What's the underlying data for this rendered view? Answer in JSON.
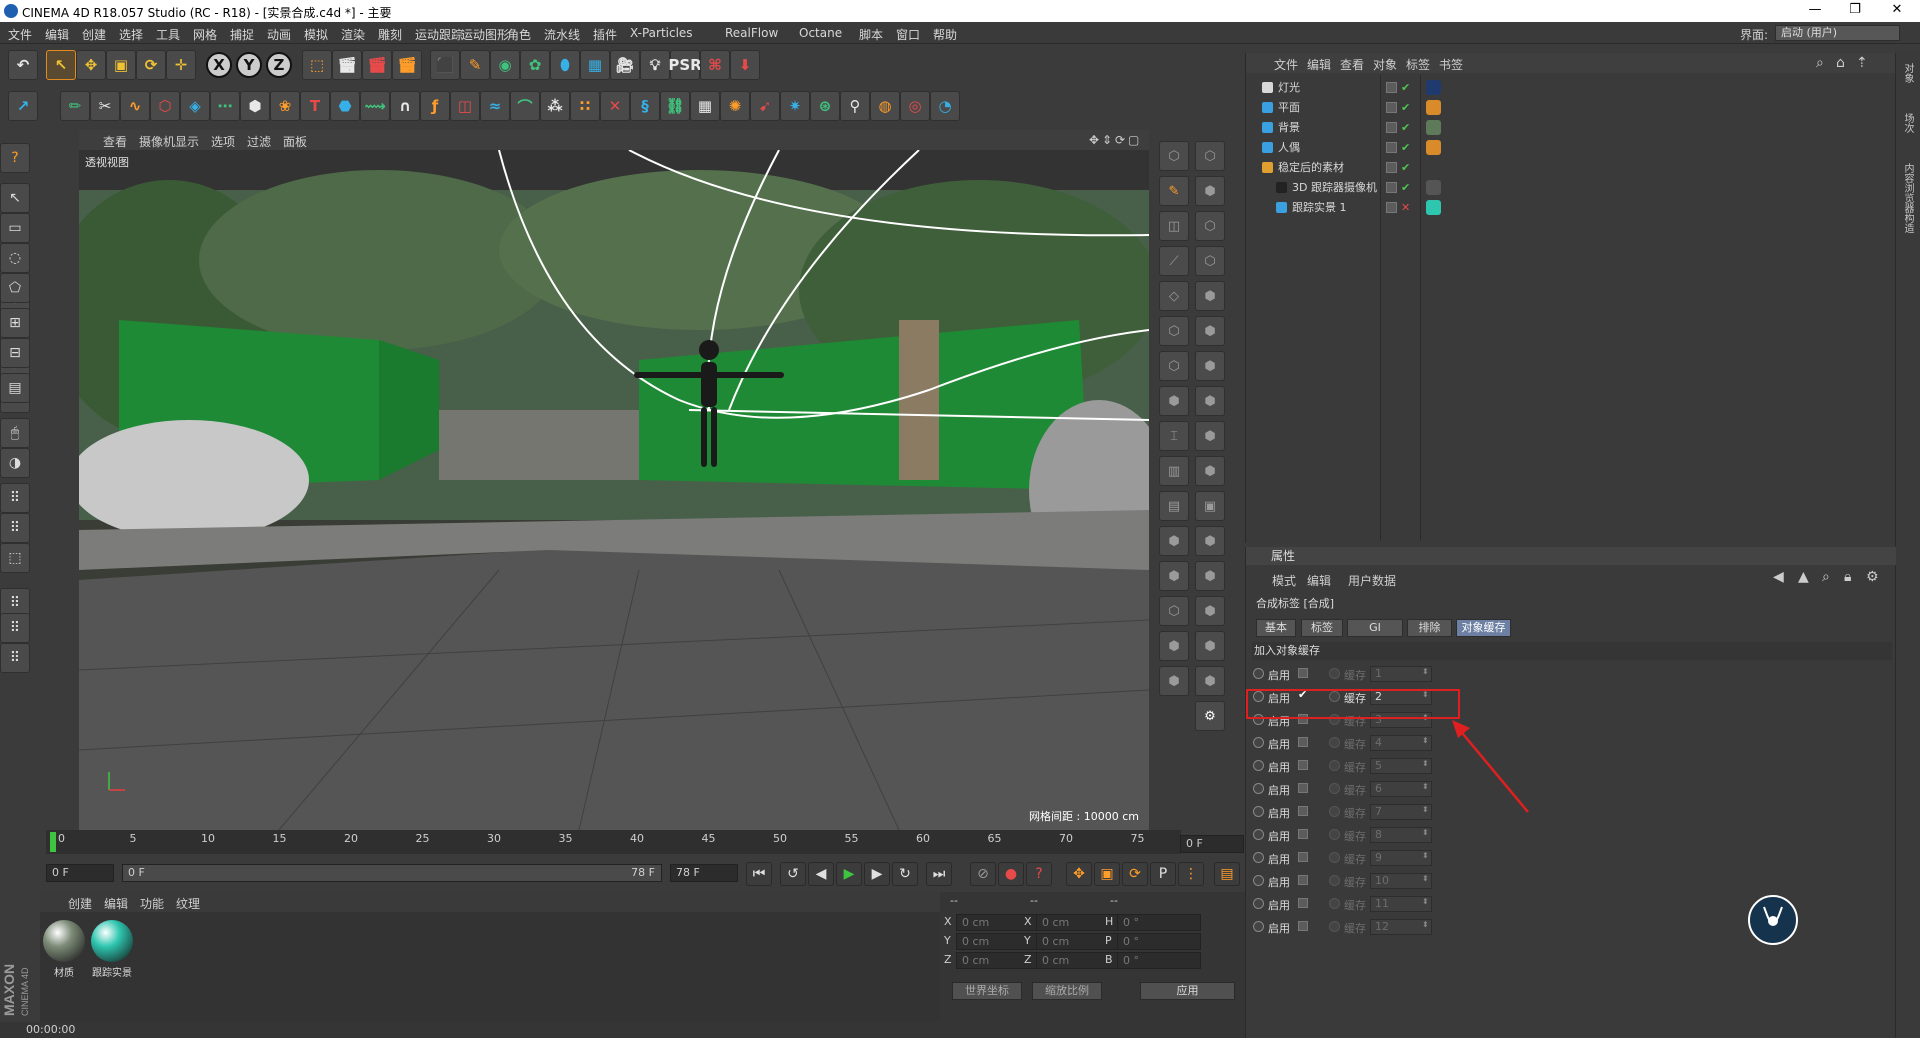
{
  "window": {
    "title": "CINEMA 4D R18.057 Studio (RC - R18) - [实景合成.c4d *] - 主要",
    "minimize": "—",
    "restore": "❐",
    "close": "✕"
  },
  "menubar": [
    "文件",
    "编辑",
    "创建",
    "选择",
    "工具",
    "网格",
    "捕捉",
    "动画",
    "模拟",
    "渲染",
    "雕刻",
    "运动跟踪",
    "运动图形",
    "角色",
    "流水线",
    "插件",
    "X-Particles",
    "RealFlow",
    "Octane",
    "脚本",
    "窗口",
    "帮助"
  ],
  "layout": {
    "label": "界面:",
    "value": "启动 (用户)"
  },
  "viewport": {
    "menu": [
      "查看",
      "摄像机",
      "显示",
      "选项",
      "过滤",
      "面板"
    ],
    "view_label": "透视视图",
    "grid_label": "网格间距 : 10000 cm"
  },
  "timeline": {
    "ticks": [
      "0",
      "5",
      "10",
      "15",
      "20",
      "25",
      "30",
      "35",
      "40",
      "45",
      "50",
      "55",
      "60",
      "65",
      "70",
      "75"
    ],
    "current_frame": "0 F"
  },
  "transport": {
    "start": "0 F",
    "range_start": "0 F",
    "range_end": "78 F",
    "end": "78 F"
  },
  "materials": {
    "menu": [
      "创建",
      "编辑",
      "功能",
      "纹理"
    ],
    "items": [
      {
        "name": "材质",
        "color": "#7d8c78"
      },
      {
        "name": "跟踪实景",
        "color": "#2fc6b0"
      }
    ]
  },
  "coords": {
    "headers": [
      "--",
      "--",
      "--"
    ],
    "rows": [
      {
        "a": "X",
        "av": "0 cm",
        "b": "X",
        "bv": "0 cm",
        "c": "H",
        "cv": "0 °"
      },
      {
        "a": "Y",
        "av": "0 cm",
        "b": "Y",
        "bv": "0 cm",
        "c": "P",
        "cv": "0 °"
      },
      {
        "a": "Z",
        "av": "0 cm",
        "b": "Z",
        "bv": "0 cm",
        "c": "B",
        "cv": "0 °"
      }
    ],
    "world": "世界坐标",
    "scale": "缩放比例",
    "apply": "应用"
  },
  "status": {
    "time": "00:00:00"
  },
  "objects": {
    "menu": [
      "文件",
      "编辑",
      "查看",
      "对象",
      "标签",
      "书签"
    ],
    "items": [
      {
        "name": "灯光",
        "indent": 0,
        "icon": "#d8d8d8"
      },
      {
        "name": "平面",
        "indent": 0,
        "icon": "#3aa0e0"
      },
      {
        "name": "背景",
        "indent": 0,
        "icon": "#3aa0e0"
      },
      {
        "name": "人偶",
        "indent": 0,
        "icon": "#3aa0e0"
      },
      {
        "name": "稳定后的素材",
        "indent": 0,
        "icon": "#e0a030"
      },
      {
        "name": "3D 跟踪器摄像机",
        "indent": 1,
        "icon": "#222222"
      },
      {
        "name": "跟踪实景 1",
        "indent": 1,
        "icon": "#3aa0e0"
      }
    ]
  },
  "sidetabs": [
    "对象",
    "场次",
    "内容浏览器",
    "构造"
  ],
  "attributes": {
    "header": "属性",
    "menu": [
      "模式",
      "编辑",
      "用户数据"
    ],
    "title": "合成标签 [合成]",
    "tabs": [
      "基本",
      "标签",
      "GI",
      "排除",
      "对象缓存"
    ],
    "active_tab": "对象缓存",
    "group": "加入对象缓存",
    "enable_label": "启用",
    "buffer_label": "缓存",
    "rows": [
      {
        "value": "1",
        "checked": false
      },
      {
        "value": "2",
        "checked": true
      },
      {
        "value": "3",
        "checked": false
      },
      {
        "value": "4",
        "checked": false
      },
      {
        "value": "5",
        "checked": false
      },
      {
        "value": "6",
        "checked": false
      },
      {
        "value": "7",
        "checked": false
      },
      {
        "value": "8",
        "checked": false
      },
      {
        "value": "9",
        "checked": false
      },
      {
        "value": "10",
        "checked": false
      },
      {
        "value": "11",
        "checked": false
      },
      {
        "value": "12",
        "checked": false
      }
    ],
    "check_mark": "✔"
  },
  "colors": {
    "highlight_box": "#e02020",
    "accent": "#e28b1f",
    "active_tab": "#6d7fa2"
  }
}
